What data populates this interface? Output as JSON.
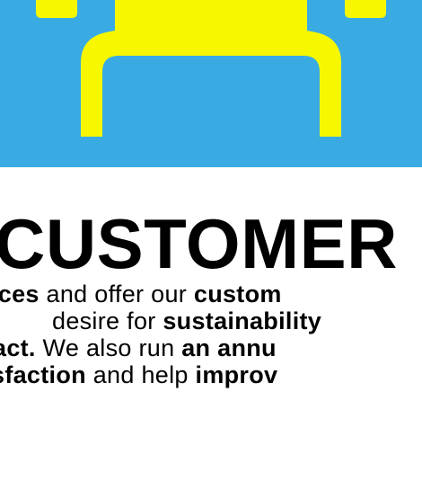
{
  "colors": {
    "hero_background": "#39ABE2",
    "hero_figure": "#F7F700",
    "text": "#000000",
    "page_background": "#FFFFFF"
  },
  "hero": {
    "icon": "customer-figure-icon"
  },
  "heading": {
    "text": "CUSTOMER"
  },
  "body": {
    "lines": [
      [
        {
          "text": "ices",
          "bold": true
        },
        {
          "text": " and offer our ",
          "bold": false
        },
        {
          "text": "custom",
          "bold": true
        }
      ],
      [
        {
          "text": "desire for ",
          "bold": false
        },
        {
          "text": "sustainability",
          "bold": true
        }
      ],
      [
        {
          "text": "act.",
          "bold": true
        },
        {
          "text": " We also run ",
          "bold": false
        },
        {
          "text": "an annu",
          "bold": true
        }
      ],
      [
        {
          "text": "sfaction",
          "bold": true
        },
        {
          "text": " and help ",
          "bold": false
        },
        {
          "text": "improv",
          "bold": true
        }
      ]
    ]
  }
}
